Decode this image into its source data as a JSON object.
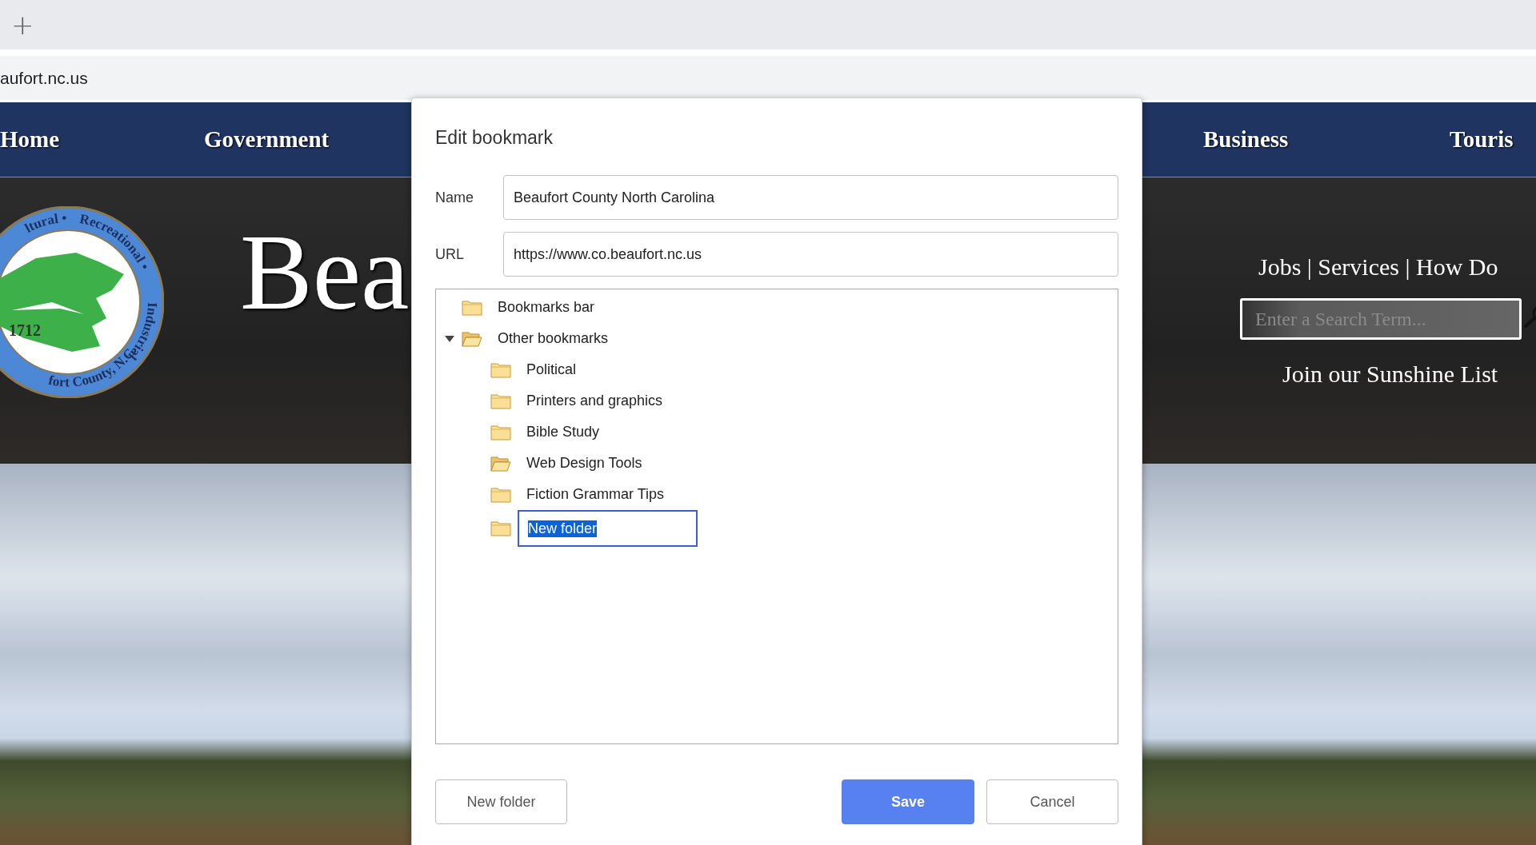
{
  "browser": {
    "new_tab_button": "+",
    "address": "aufort.nc.us"
  },
  "site": {
    "nav": [
      "Home",
      "Government",
      "Business",
      "Touris"
    ],
    "seal": {
      "top_text": [
        "ltural •",
        "Recreational •",
        "Industrial"
      ],
      "year": "1712",
      "bottom_text": "fort County, N.C."
    },
    "title": "Bea",
    "quick_links": "Jobs | Services | How Do",
    "search": {
      "placeholder": "Enter a Search Term..."
    },
    "sunshine_link": "Join our Sunshine List"
  },
  "dialog": {
    "title": "Edit bookmark",
    "fields": [
      {
        "label": "Name",
        "value": "Beaufort County North Carolina"
      },
      {
        "label": "URL",
        "value": "https://www.co.beaufort.nc.us"
      }
    ],
    "tree": [
      {
        "label": "Bookmarks bar"
      },
      {
        "label": "Other bookmarks",
        "expanded": true,
        "children": [
          {
            "label": "Political",
            "current": false,
            "editing": false
          },
          {
            "label": "Printers and graphics",
            "current": false,
            "editing": false
          },
          {
            "label": "Bible Study",
            "current": false,
            "editing": false
          },
          {
            "label": "Web Design Tools",
            "current": true,
            "editing": false
          },
          {
            "label": "Fiction Grammar Tips",
            "current": false,
            "editing": false
          },
          {
            "label": "New folder",
            "current": false,
            "editing": true
          }
        ]
      }
    ],
    "buttons": [
      {
        "label": "New folder",
        "kind": "secondary"
      },
      {
        "label": "Save",
        "kind": "primary"
      },
      {
        "label": "Cancel",
        "kind": "secondary"
      }
    ]
  }
}
